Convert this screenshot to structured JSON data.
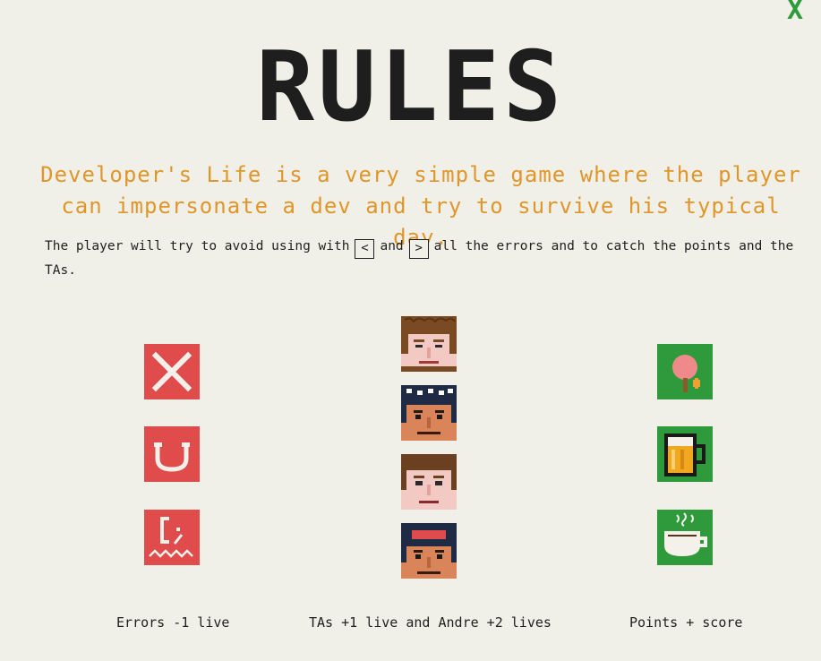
{
  "close_label": "X",
  "title": "RULES",
  "intro": "Developer's Life is a very simple game where the player can impersonate a dev and try to survive his typical day.",
  "rules": {
    "part1": "The player will try to avoid using with",
    "key_left": "<",
    "and": "and",
    "key_right": ">",
    "part2": "all the errors and to catch the points and the TAs."
  },
  "captions": {
    "errors": "Errors -1 live",
    "tas": "TAs +1 live and Andre +2 lives",
    "points": "Points + score"
  },
  "icons": {
    "errors": [
      "x-error-icon",
      "magnet-error-icon",
      "bracket-error-icon"
    ],
    "tas": [
      "ta-face-1",
      "ta-face-2",
      "ta-face-3",
      "andre-face"
    ],
    "points": [
      "ping-pong-icon",
      "beer-icon",
      "coffee-icon"
    ]
  },
  "colors": {
    "background": "#f1f0e8",
    "title": "#1e1e1e",
    "intro": "#e0962a",
    "error_tile": "#e04b4b",
    "point_tile": "#2e9a3c"
  }
}
